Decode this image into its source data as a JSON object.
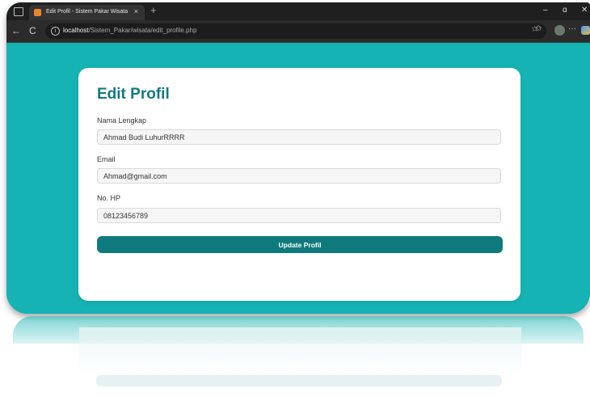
{
  "browser": {
    "tab_title": "Edit Profil - Sistem Pakar Wisata",
    "tab_close": "×",
    "new_tab": "+",
    "url_host": "localhost",
    "url_path": "/Sistem_Pakar/wisata/edit_profile.php",
    "minimize": "–",
    "restore": "ɑ",
    "close": "✕",
    "back": "←",
    "reload": "C",
    "more": "···"
  },
  "form": {
    "title": "Edit Profil",
    "name_label": "Nama Lengkap",
    "name_value": "Ahmad Budi LuhurRRRR",
    "email_label": "Email",
    "email_value": "Ahmad@gmail.com",
    "phone_label": "No. HP",
    "phone_value": "08123456789",
    "submit_label": "Update Profil"
  },
  "colors": {
    "page_bg": "#15b3b3",
    "title": "#157a7d",
    "button": "#0f7a7d"
  }
}
